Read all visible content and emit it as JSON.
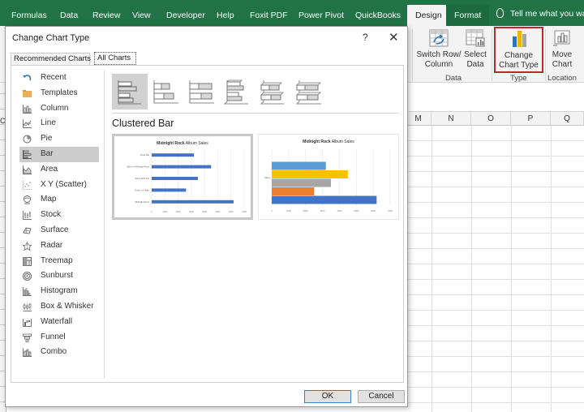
{
  "ribbon_tabs": [
    {
      "label": "Formulas"
    },
    {
      "label": "Data"
    },
    {
      "label": "Review"
    },
    {
      "label": "View"
    },
    {
      "label": "Developer"
    },
    {
      "label": "Help"
    },
    {
      "label": "Foxit PDF"
    },
    {
      "label": "Power Pivot"
    },
    {
      "label": "QuickBooks"
    },
    {
      "label": "Design",
      "active": true
    },
    {
      "label": "Format"
    }
  ],
  "tell_me": "Tell me what you wa",
  "ribbon": {
    "switch_row_column": {
      "line1": "Switch Row/",
      "line2": "Column"
    },
    "select_data": {
      "line1": "Select",
      "line2": "Data"
    },
    "change_chart_type": {
      "line1": "Change",
      "line2": "Chart Type"
    },
    "move_chart": {
      "line1": "Move",
      "line2": "Chart"
    },
    "groups": {
      "data": "Data",
      "type": "Type",
      "location": "Location"
    },
    "highlight_color": "#c0272d"
  },
  "columns": [
    "M",
    "N",
    "O",
    "P",
    "Q"
  ],
  "left_column_partial": "C",
  "dialog": {
    "title": "Change Chart Type",
    "help": "?",
    "close": "✕",
    "tabs": [
      {
        "label": "Recommended Charts",
        "active": false
      },
      {
        "label": "All Charts",
        "active": true
      }
    ],
    "chart_types": [
      {
        "label": "Recent",
        "icon": "recent-icon"
      },
      {
        "label": "Templates",
        "icon": "templates-folder-icon"
      },
      {
        "label": "Column",
        "icon": "column-chart-icon"
      },
      {
        "label": "Line",
        "icon": "line-chart-icon"
      },
      {
        "label": "Pie",
        "icon": "pie-chart-icon"
      },
      {
        "label": "Bar",
        "icon": "bar-chart-icon",
        "selected": true
      },
      {
        "label": "Area",
        "icon": "area-chart-icon"
      },
      {
        "label": "X Y (Scatter)",
        "icon": "scatter-chart-icon"
      },
      {
        "label": "Map",
        "icon": "map-chart-icon"
      },
      {
        "label": "Stock",
        "icon": "stock-chart-icon"
      },
      {
        "label": "Surface",
        "icon": "surface-chart-icon"
      },
      {
        "label": "Radar",
        "icon": "radar-chart-icon"
      },
      {
        "label": "Treemap",
        "icon": "treemap-chart-icon"
      },
      {
        "label": "Sunburst",
        "icon": "sunburst-chart-icon"
      },
      {
        "label": "Histogram",
        "icon": "histogram-chart-icon"
      },
      {
        "label": "Box & Whisker",
        "icon": "box-whisker-chart-icon"
      },
      {
        "label": "Waterfall",
        "icon": "waterfall-chart-icon"
      },
      {
        "label": "Funnel",
        "icon": "funnel-chart-icon"
      },
      {
        "label": "Combo",
        "icon": "combo-chart-icon"
      }
    ],
    "subtypes": [
      {
        "name": "clustered-bar",
        "selected": true
      },
      {
        "name": "stacked-bar"
      },
      {
        "name": "100-stacked-bar"
      },
      {
        "name": "3d-clustered-bar"
      },
      {
        "name": "3d-stacked-bar"
      },
      {
        "name": "3d-100-stacked-bar"
      }
    ],
    "selected_subtype_label": "Clustered Bar",
    "previews": [
      {
        "title_bold": "Midnight Rock",
        "title_rest": " Album Sales",
        "categories": [
          "Midnight Rock",
          "Rock on Night",
          "Rock With Me",
          "Best of Midnight Rock",
          "Rock Me"
        ],
        "values": [
          6200,
          2600,
          3500,
          4500,
          3200
        ],
        "ticks": [
          "0",
          "1000",
          "2000",
          "3000",
          "4000",
          "5000",
          "6000",
          "7000"
        ],
        "xmax": 7000,
        "bar_color": "#4472c4"
      },
      {
        "title_bold": "Midnight Rock",
        "title_rest": " Album Sales",
        "category_label": "Sales",
        "values": [
          6200,
          2500,
          3500,
          4500,
          3200
        ],
        "colors": [
          "#4472c4",
          "#ed7d31",
          "#a5a5a5",
          "#ffc000",
          "#5b9bd5"
        ],
        "ticks": [
          "0",
          "1000",
          "2000",
          "3000",
          "4000",
          "5000",
          "6000",
          "7000"
        ],
        "xmax": 7000
      }
    ],
    "ok_label": "OK",
    "cancel_label": "Cancel"
  },
  "colors": {
    "ribbon_green": "#217346",
    "accent_blue": "#4472c4"
  }
}
